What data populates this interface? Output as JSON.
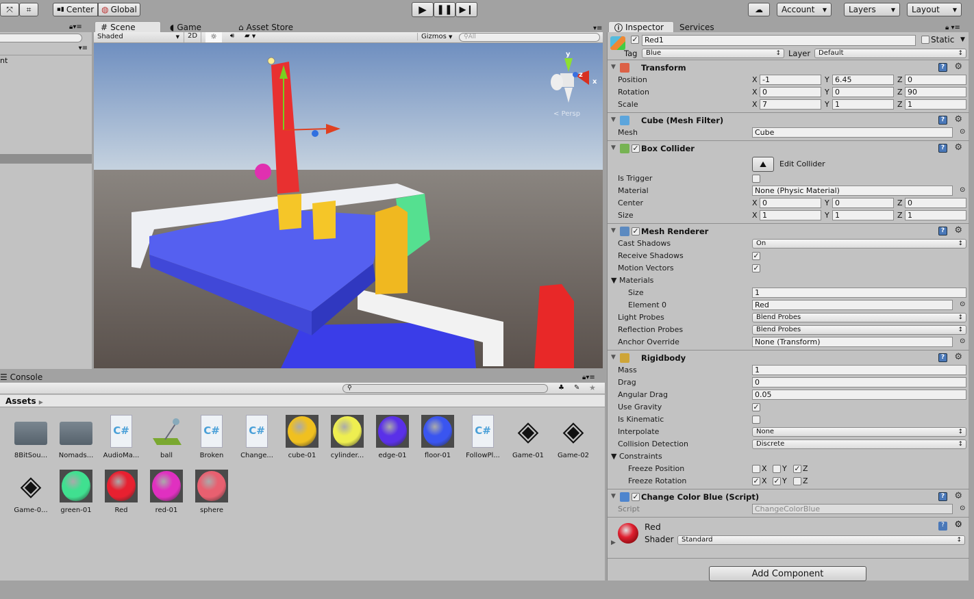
{
  "toolbar": {
    "pivot": "Center",
    "space": "Global",
    "account": "Account",
    "layers": "Layers",
    "layout": "Layout"
  },
  "hierarchy": {
    "partial_item": "nt"
  },
  "scene": {
    "tabs": [
      "Scene",
      "Game",
      "Asset Store"
    ],
    "shading": "Shaded",
    "mode2d": "2D",
    "gizmos": "Gizmos",
    "search_placeholder": "All",
    "persp": "Persp",
    "axes": {
      "x": "x",
      "y": "y",
      "z": "z"
    }
  },
  "console": {
    "tab": "Console"
  },
  "project": {
    "breadcrumb": "Assets",
    "search_placeholder": "",
    "assets": [
      {
        "name": "8BitSou...",
        "kind": "folder"
      },
      {
        "name": "Nomads...",
        "kind": "folder"
      },
      {
        "name": "AudioMa...",
        "kind": "script"
      },
      {
        "name": "ball",
        "kind": "physic"
      },
      {
        "name": "Broken",
        "kind": "script"
      },
      {
        "name": "Change...",
        "kind": "script"
      },
      {
        "name": "cube-01",
        "kind": "material",
        "color": "#f0c020"
      },
      {
        "name": "cylinder...",
        "kind": "material",
        "color": "#eeee50"
      },
      {
        "name": "edge-01",
        "kind": "material",
        "color": "#5a30e8"
      },
      {
        "name": "floor-01",
        "kind": "material",
        "color": "#3a55f0"
      },
      {
        "name": "FollowPl...",
        "kind": "script"
      },
      {
        "name": "Game-01",
        "kind": "unity"
      },
      {
        "name": "Game-02",
        "kind": "unity"
      },
      {
        "name": "Game-0...",
        "kind": "unity"
      },
      {
        "name": "green-01",
        "kind": "material",
        "color": "#40e090"
      },
      {
        "name": "Red",
        "kind": "material",
        "color": "#e82030"
      },
      {
        "name": "red-01",
        "kind": "material",
        "color": "#e030c0"
      },
      {
        "name": "sphere",
        "kind": "material",
        "color": "#e86070"
      }
    ]
  },
  "inspector": {
    "tabs": [
      "Inspector",
      "Services"
    ],
    "object_name": "Red1",
    "static_label": "Static",
    "tag_label": "Tag",
    "tag": "Blue",
    "layer_label": "Layer",
    "layer": "Default",
    "components": [
      {
        "title": "Transform",
        "icon": "transform",
        "check": false,
        "rows": [
          {
            "type": "vec3",
            "label": "Position",
            "values": [
              "-1",
              "6.45",
              "0"
            ]
          },
          {
            "type": "vec3",
            "label": "Rotation",
            "values": [
              "0",
              "0",
              "90"
            ]
          },
          {
            "type": "vec3",
            "label": "Scale",
            "values": [
              "7",
              "1",
              "1"
            ]
          }
        ]
      },
      {
        "title": "Cube (Mesh Filter)",
        "icon": "mesh",
        "check": false,
        "rows": [
          {
            "type": "object",
            "label": "Mesh",
            "value": "Cube"
          }
        ]
      },
      {
        "title": "Box Collider",
        "icon": "collider",
        "check": true,
        "rows": [
          {
            "type": "button",
            "label": "",
            "value": "Edit Collider"
          },
          {
            "type": "checkbox",
            "label": "Is Trigger",
            "value": false
          },
          {
            "type": "object",
            "label": "Material",
            "value": "None (Physic Material)"
          },
          {
            "type": "vec3",
            "label": "Center",
            "values": [
              "0",
              "0",
              "0"
            ]
          },
          {
            "type": "vec3",
            "label": "Size",
            "values": [
              "1",
              "1",
              "1"
            ]
          }
        ]
      },
      {
        "title": "Mesh Renderer",
        "icon": "renderer",
        "check": true,
        "rows": [
          {
            "type": "dropdown",
            "label": "Cast Shadows",
            "value": "On"
          },
          {
            "type": "checkbox",
            "label": "Receive Shadows",
            "value": true
          },
          {
            "type": "checkbox",
            "label": "Motion Vectors",
            "value": true
          },
          {
            "type": "foldout",
            "label": "Materials"
          },
          {
            "type": "text",
            "label": "Size",
            "value": "1",
            "indent": true
          },
          {
            "type": "object",
            "label": "Element 0",
            "value": "Red",
            "indent": true
          },
          {
            "type": "dropdown",
            "label": "Light Probes",
            "value": "Blend Probes"
          },
          {
            "type": "dropdown",
            "label": "Reflection Probes",
            "value": "Blend Probes"
          },
          {
            "type": "object",
            "label": "Anchor Override",
            "value": "None (Transform)"
          }
        ]
      },
      {
        "title": "Rigidbody",
        "icon": "rigidbody",
        "check": false,
        "rows": [
          {
            "type": "text",
            "label": "Mass",
            "value": "1"
          },
          {
            "type": "text",
            "label": "Drag",
            "value": "0"
          },
          {
            "type": "text",
            "label": "Angular Drag",
            "value": "0.05"
          },
          {
            "type": "checkbox",
            "label": "Use Gravity",
            "value": true
          },
          {
            "type": "checkbox",
            "label": "Is Kinematic",
            "value": false
          },
          {
            "type": "dropdown",
            "label": "Interpolate",
            "value": "None"
          },
          {
            "type": "dropdown",
            "label": "Collision Detection",
            "value": "Discrete"
          },
          {
            "type": "foldout",
            "label": "Constraints"
          },
          {
            "type": "xyz",
            "label": "Freeze Position",
            "values": [
              false,
              false,
              true
            ],
            "indent": true
          },
          {
            "type": "xyz",
            "label": "Freeze Rotation",
            "values": [
              true,
              true,
              false
            ],
            "indent": true
          }
        ]
      },
      {
        "title": "Change Color Blue (Script)",
        "icon": "script",
        "check": true,
        "rows": [
          {
            "type": "object",
            "label": "Script",
            "value": "ChangeColorBlue",
            "disabled": true
          }
        ]
      }
    ],
    "material": {
      "name": "Red",
      "shader_label": "Shader",
      "shader": "Standard",
      "color": "#e02030"
    },
    "add_component": "Add Component"
  }
}
